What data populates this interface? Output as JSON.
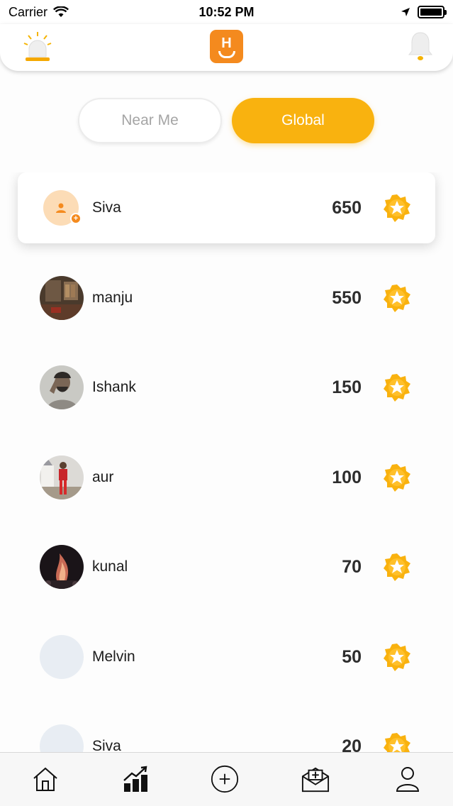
{
  "status_bar": {
    "carrier": "Carrier",
    "time": "10:52 PM"
  },
  "header": {
    "left_icon": "siren-icon",
    "logo_letter": "H",
    "right_icon": "bell-icon"
  },
  "tabs": {
    "near_me": "Near Me",
    "global": "Global",
    "selected": "Global"
  },
  "colors": {
    "accent": "#f9b20f",
    "brand": "#f48a1e",
    "coin": "#f9b20f"
  },
  "leaderboard": [
    {
      "name": "Siva",
      "points": "650",
      "avatar": "placeholder-user-icon",
      "is_current_user": true
    },
    {
      "name": "manju",
      "points": "550",
      "avatar": "photo"
    },
    {
      "name": "Ishank",
      "points": "150",
      "avatar": "photo"
    },
    {
      "name": "aur",
      "points": "100",
      "avatar": "photo"
    },
    {
      "name": "kunal",
      "points": "70",
      "avatar": "photo"
    },
    {
      "name": "Melvin",
      "points": "50",
      "avatar": "empty"
    },
    {
      "name": "Siva",
      "points": "20",
      "avatar": "empty"
    }
  ],
  "bottom_nav": [
    "home-icon",
    "leaderboard-icon",
    "add-icon",
    "envelope-icon",
    "profile-icon"
  ]
}
